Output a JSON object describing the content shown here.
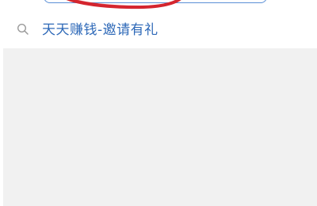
{
  "search_suggestion": {
    "text": "天天赚钱-邀请有礼",
    "icon": "search-icon"
  },
  "colors": {
    "link_text": "#2e69b8",
    "annotation": "#d4252e",
    "search_border": "#5b8fd6",
    "content_bg": "#f1f1f1"
  }
}
